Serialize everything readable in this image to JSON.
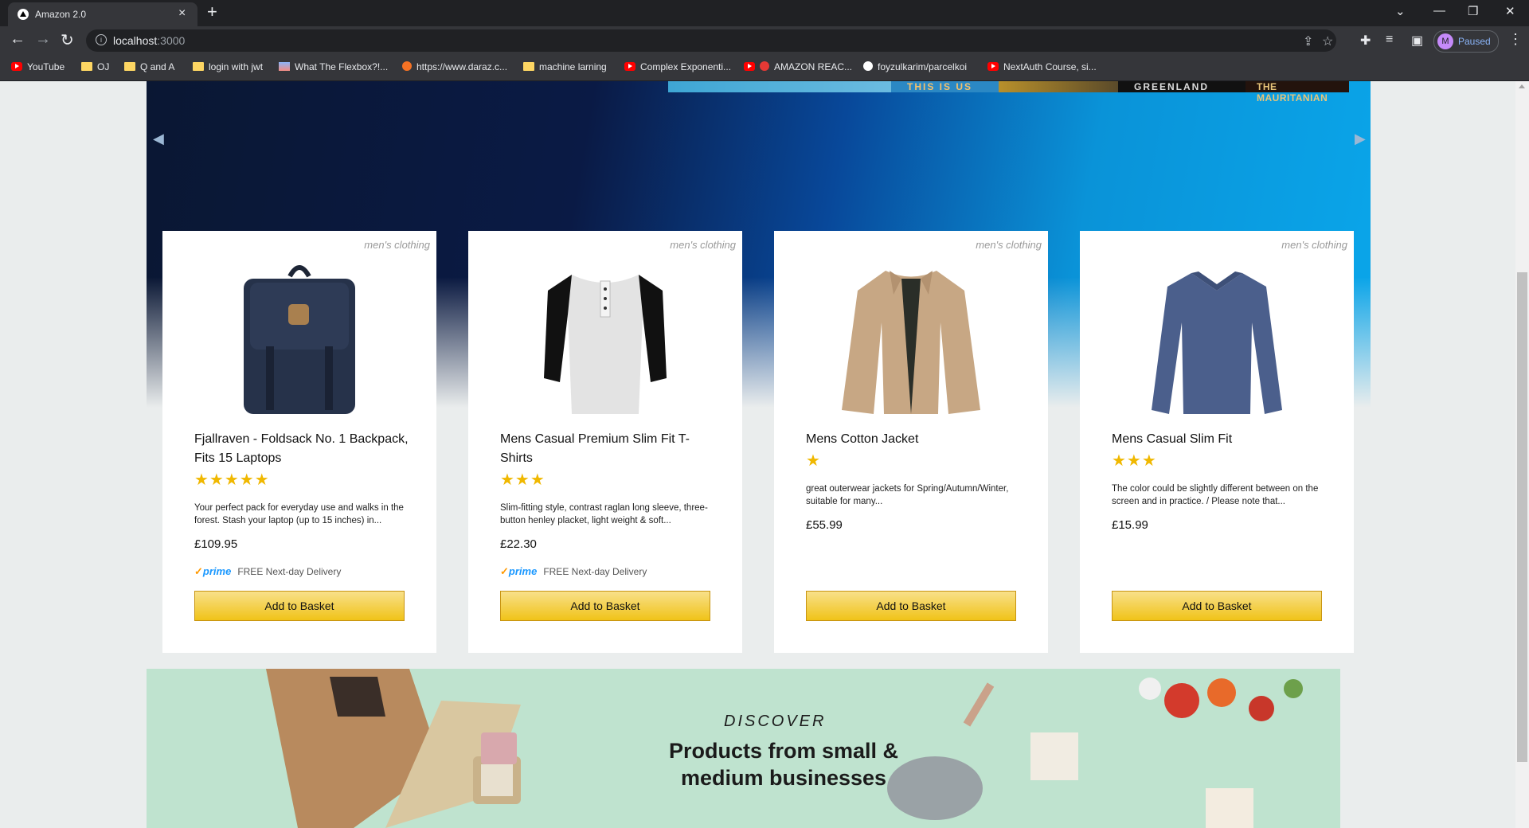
{
  "browser": {
    "tab_title": "Amazon 2.0",
    "url_host": "localhost",
    "url_port": ":3000",
    "profile_initial": "M",
    "profile_status": "Paused"
  },
  "bookmarks": [
    {
      "label": "YouTube",
      "icon": "youtube-icon"
    },
    {
      "label": "OJ",
      "icon": "folder-icon"
    },
    {
      "label": "Q and A",
      "icon": "folder-icon"
    },
    {
      "label": "login with jwt",
      "icon": "folder-icon"
    },
    {
      "label": "What The Flexbox?!...",
      "icon": "flexbox-icon"
    },
    {
      "label": "https://www.daraz.c...",
      "icon": "daraz-icon"
    },
    {
      "label": "machine larning",
      "icon": "folder-icon"
    },
    {
      "label": "Complex Exponenti...",
      "icon": "youtube-icon"
    },
    {
      "label": "AMAZON REAC...",
      "icon": "youtube-icon"
    },
    {
      "label": "foyzulkarim/parcelkoi",
      "icon": "github-icon"
    },
    {
      "label": "NextAuth Course, si...",
      "icon": "youtube-icon"
    }
  ],
  "hero": {
    "strip_labels": [
      "THIS IS US",
      "GREENLAND",
      "THE MAURITANIAN"
    ]
  },
  "products": [
    {
      "category": "men's clothing",
      "title": "Fjallraven - Foldsack No. 1 Backpack, Fits 15 Laptops",
      "rating": 5,
      "stars": "★★★★★",
      "description": "Your perfect pack for everyday use and walks in the forest. Stash your laptop (up to 15 inches) in...",
      "price": "£109.95",
      "prime": true,
      "prime_label": "prime",
      "delivery": "FREE Next-day Delivery",
      "button": "Add to Basket"
    },
    {
      "category": "men's clothing",
      "title": "Mens Casual Premium Slim Fit T-Shirts",
      "rating": 3,
      "stars": "★★★",
      "description": "Slim-fitting style, contrast raglan long sleeve, three-button henley placket, light weight & soft...",
      "price": "£22.30",
      "prime": true,
      "prime_label": "prime",
      "delivery": "FREE Next-day Delivery",
      "button": "Add to Basket"
    },
    {
      "category": "men's clothing",
      "title": "Mens Cotton Jacket",
      "rating": 1,
      "stars": "★",
      "description": "great outerwear jackets for Spring/Autumn/Winter, suitable for many...",
      "price": "£55.99",
      "prime": false,
      "button": "Add to Basket"
    },
    {
      "category": "men's clothing",
      "title": "Mens Casual Slim Fit",
      "rating": 3,
      "stars": "★★★",
      "description": "The color could be slightly different between on the screen and in practice. / Please note that...",
      "price": "£15.99",
      "prime": false,
      "button": "Add to Basket"
    }
  ],
  "banner": {
    "kicker": "DISCOVER",
    "title": "Products from small & medium businesses"
  },
  "colors": {
    "chrome_dark": "#202124",
    "chrome_toolbar": "#35363a",
    "page_bg": "#eaeded",
    "button_yellow": "#f0c318",
    "star": "#f0b800",
    "prime_blue": "#1a98ff"
  }
}
